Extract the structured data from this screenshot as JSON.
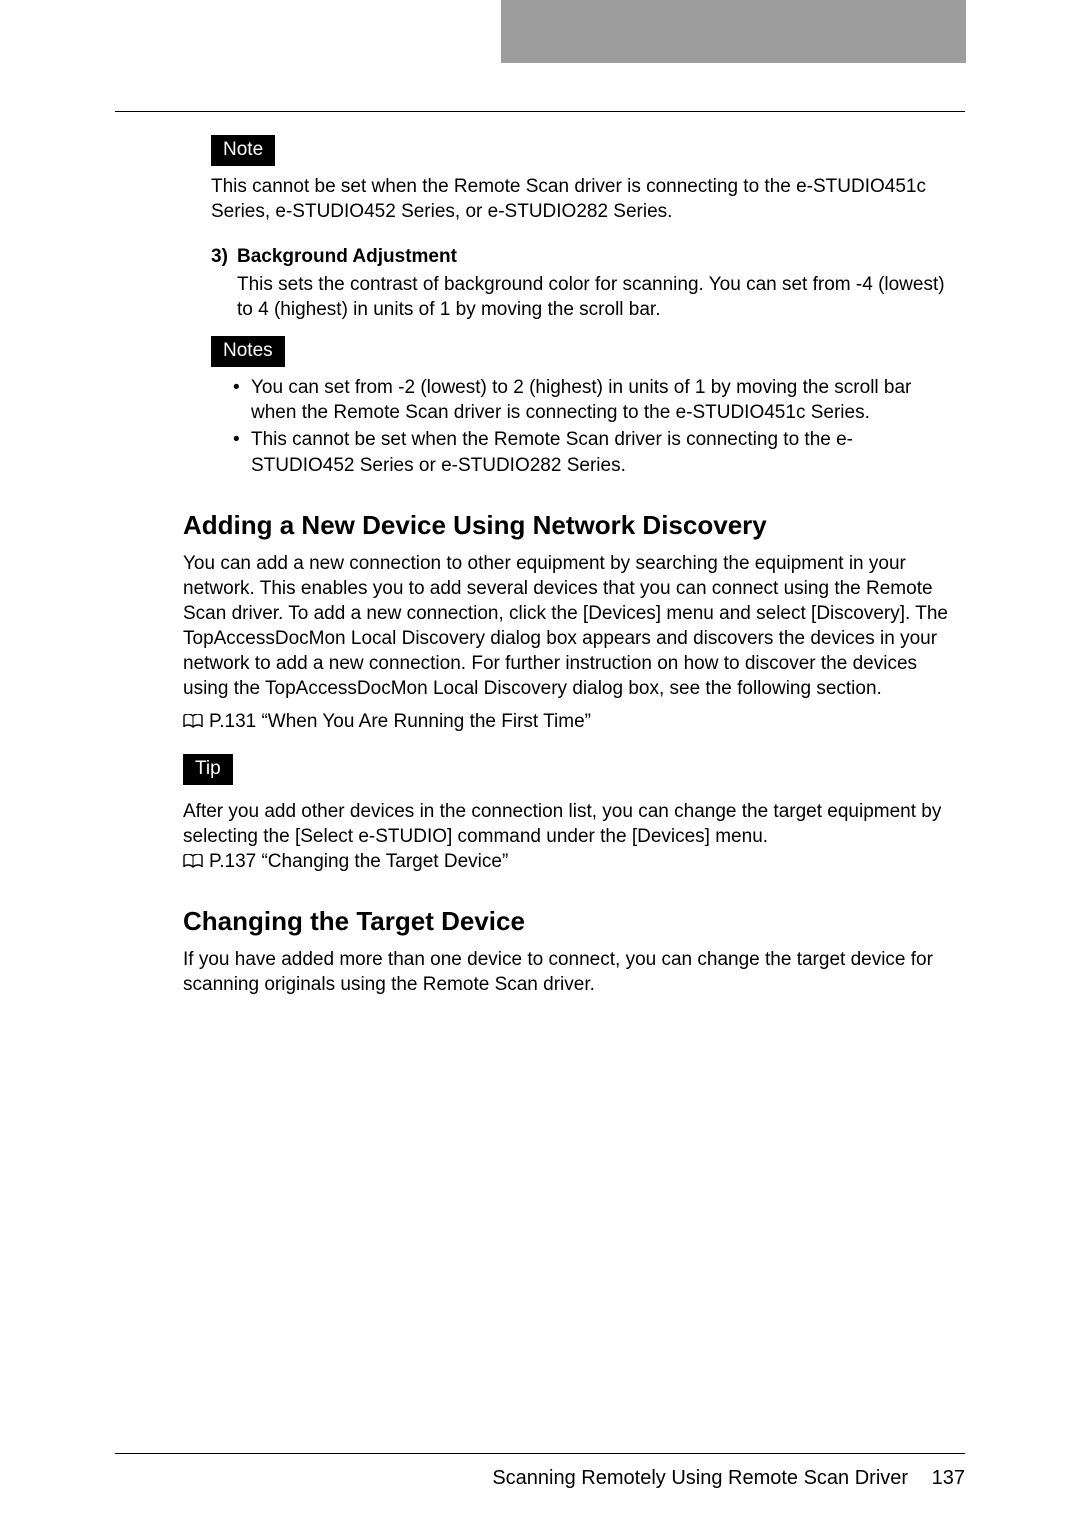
{
  "badges": {
    "note": "Note",
    "notes": "Notes",
    "tip": "Tip"
  },
  "note1": "This cannot be set when the Remote Scan driver is connecting to the e-STUDIO451c Series, e-STUDIO452 Series, or e-STUDIO282 Series.",
  "item3": {
    "num": "3)",
    "title": "Background Adjustment",
    "desc": "This sets the contrast of background color for scanning.  You can set from -4 (lowest) to 4 (highest) in units of 1 by moving the scroll bar."
  },
  "notes_bullets": [
    "You can set from -2 (lowest) to 2 (highest) in units of 1 by moving the scroll bar when the Remote Scan driver is connecting to the e-STUDIO451c Series.",
    "This cannot be set when the Remote Scan driver is connecting to the e-STUDIO452 Series or e-STUDIO282 Series."
  ],
  "section1": {
    "heading": "Adding a New Device Using Network Discovery",
    "para": "You can add a new connection to other equipment by searching the equipment in your network. This enables you to add several devices that you can connect using the Remote Scan driver. To add a new connection, click the [Devices] menu and select [Discovery].  The TopAccessDocMon Local Discovery dialog box appears and discovers the devices in your network to add a new connection.  For further instruction on how to discover the devices using the TopAccessDocMon Local Discovery dialog box, see the following section.",
    "ref": "P.131 “When You Are Running the First Time”"
  },
  "tip": {
    "text": "After you add other devices in the connection list, you can change the target equipment by selecting the [Select e-STUDIO] command under the [Devices] menu.",
    "ref": "P.137 “Changing the Target Device”"
  },
  "section2": {
    "heading": "Changing the Target Device",
    "para": "If you have added more than one device to connect, you can change the target device for scanning originals using the Remote Scan driver."
  },
  "footer": {
    "text": "Scanning Remotely Using Remote Scan Driver",
    "page": "137"
  }
}
